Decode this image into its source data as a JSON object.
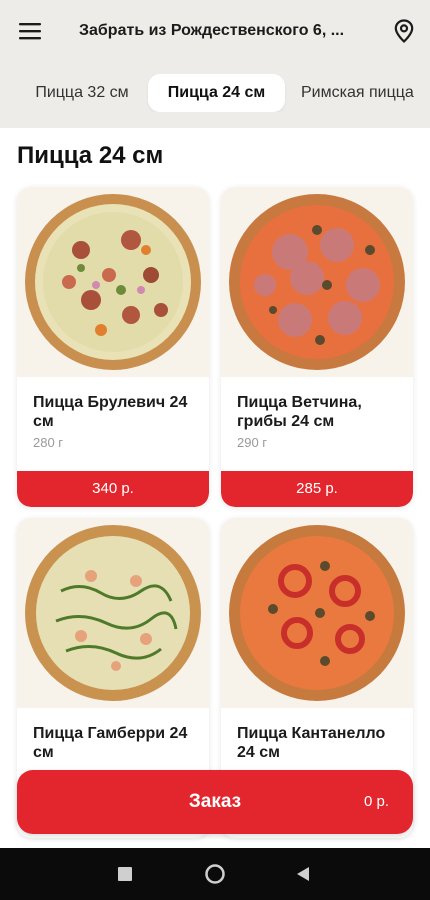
{
  "header": {
    "menu_icon": "hamburger-menu-icon",
    "address": "Забрать из Рождественского 6, ...",
    "location_icon": "map-pin-icon"
  },
  "tabs": [
    {
      "label": "Пицца 32 см",
      "active": false
    },
    {
      "label": "Пицца 24 см",
      "active": true
    },
    {
      "label": "Римская пицца",
      "active": false
    }
  ],
  "section_title": "Пицца 24 см",
  "products": [
    {
      "name": "Пицца Брулевич 24 см",
      "weight": "280 г",
      "price": "340 р.",
      "image": "pizza-brulevich-image"
    },
    {
      "name": "Пицца Ветчина, грибы 24 см",
      "weight": "290 г",
      "price": "285 р.",
      "image": "pizza-ham-mushrooms-image"
    },
    {
      "name": "Пицца Гамберри 24 см",
      "weight": "",
      "price": "",
      "image": "pizza-gamberri-image"
    },
    {
      "name": "Пицца Кантанелло 24 см",
      "weight": "",
      "price": "",
      "image": "pizza-cantanello-image"
    }
  ],
  "order": {
    "label": "Заказ",
    "total": "0 р."
  },
  "colors": {
    "accent": "#e3262e",
    "topbar": "#eeece8",
    "card_image_bg": "#f7f2ea"
  },
  "system_nav": [
    "recent-apps-icon",
    "home-icon",
    "back-icon"
  ]
}
